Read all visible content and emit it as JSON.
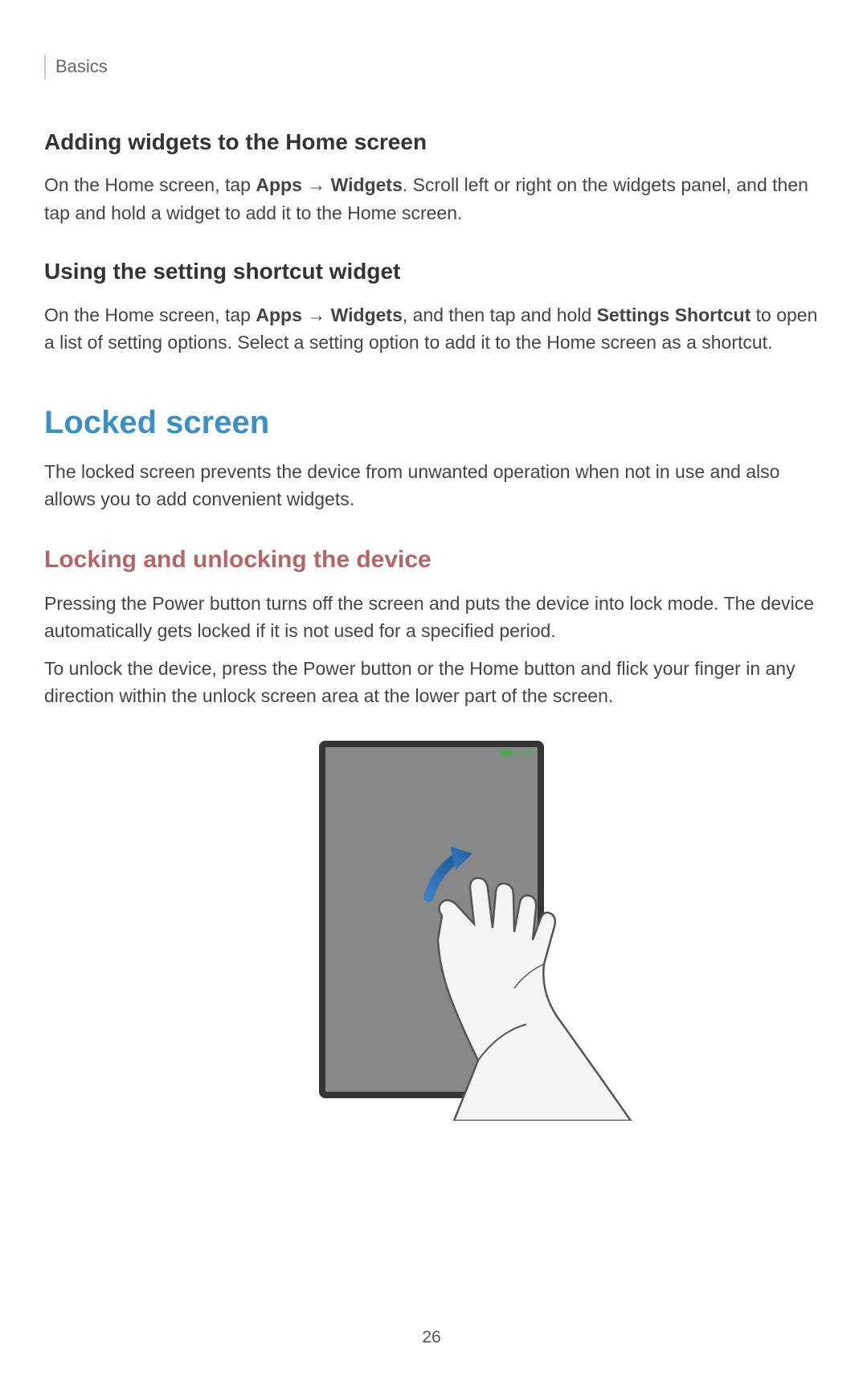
{
  "header": {
    "section": "Basics"
  },
  "section1": {
    "heading": "Adding widgets to the Home screen",
    "text_pre": "On the Home screen, tap ",
    "bold1": "Apps",
    "arrow": " → ",
    "bold2": "Widgets",
    "text_post": ". Scroll left or right on the widgets panel, and then tap and hold a widget to add it to the Home screen."
  },
  "section2": {
    "heading": "Using the setting shortcut widget",
    "text_pre": "On the Home screen, tap ",
    "bold1": "Apps",
    "arrow": " → ",
    "bold2": "Widgets",
    "text_mid": ", and then tap and hold ",
    "bold3": "Settings Shortcut",
    "text_post": " to open a list of setting options. Select a setting option to add it to the Home screen as a shortcut."
  },
  "section3": {
    "heading": "Locked screen",
    "text": "The locked screen prevents the device from unwanted operation when not in use and also allows you to add convenient widgets."
  },
  "section4": {
    "heading": "Locking and unlocking the device",
    "text1": "Pressing the Power button turns off the screen and puts the device into lock mode. The device automatically gets locked if it is not used for a specified period.",
    "text2": "To unlock the device, press the Power button or the Home button and flick your finger in any direction within the unlock screen area at the lower part of the screen."
  },
  "device": {
    "time": "10:00"
  },
  "footer": {
    "page_number": "26"
  }
}
